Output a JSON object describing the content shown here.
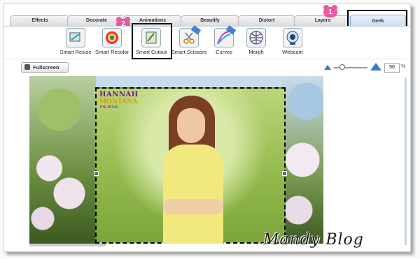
{
  "tabs": [
    {
      "label": "Effects"
    },
    {
      "label": "Decorate"
    },
    {
      "label": "Animations"
    },
    {
      "label": "Beautify"
    },
    {
      "label": "Distort"
    },
    {
      "label": "Layers"
    },
    {
      "label": "Geek"
    }
  ],
  "active_tab": "Geek",
  "annotations": {
    "badge1": "1",
    "badge2": "2"
  },
  "tools": [
    {
      "label": "Smart Resize",
      "icon": "smart-resize-icon"
    },
    {
      "label": "Smart Recolor",
      "icon": "smart-recolor-icon"
    },
    {
      "label": "Smart Cutout",
      "icon": "smart-cutout-icon"
    },
    {
      "label": "Smart Scissors",
      "icon": "smart-scissors-icon"
    },
    {
      "label": "Curves",
      "icon": "curves-icon"
    },
    {
      "label": "Morph",
      "icon": "morph-icon"
    },
    {
      "label": "Webcam",
      "icon": "webcam-icon"
    }
  ],
  "fullscreen": {
    "label": "Fullscreen"
  },
  "zoom": {
    "value": "50",
    "unit": "%"
  },
  "logo": {
    "line1": "HANNAH",
    "line2": "MONTANA",
    "line3": "THE MOVIE"
  },
  "watermark": "Mandy Blog",
  "colors": {
    "accent": "#3b78c6",
    "badge": "#e85aa6",
    "highlight": "#000000"
  }
}
